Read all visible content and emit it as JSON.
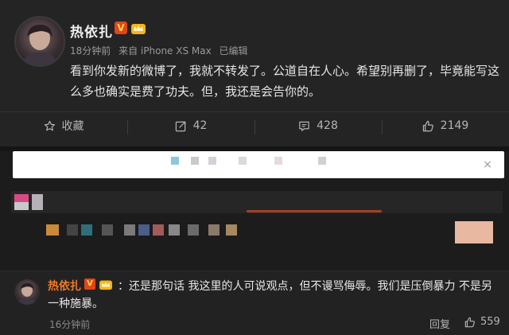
{
  "post": {
    "username": "热依扎",
    "v_badge": "V",
    "meta": {
      "time": "18分钟前",
      "source": "来自 iPhone XS Max",
      "edited": "已编辑"
    },
    "content": "看到你发新的微博了，我就不转发了。公道自在人心。希望别再删了，毕竟能写这么多也确实是费了功夫。但，我还是会告你的。",
    "actions": {
      "favorite": "收藏",
      "repost": "42",
      "comment": "428",
      "like": "2149"
    },
    "icons": {
      "favorite": "star-icon",
      "repost": "repost-icon",
      "comment": "comment-icon",
      "like": "thumbs-up-icon"
    }
  },
  "compose": {
    "close": "×"
  },
  "reply": {
    "username": "热依扎",
    "v_badge": "V",
    "text": "：还是那句话 我这里的人可说观点，但不谩骂侮辱。我们是压倒暴力 不是另一种施暴。",
    "time": "16分钟前",
    "reply_label": "回复",
    "likes": "559"
  },
  "colors": {
    "background": "#1c1c1c",
    "card": "#242424",
    "accent_name": "#f07a2a",
    "badge_red": "#e0451b",
    "badge_gold": "#ffd24a"
  }
}
